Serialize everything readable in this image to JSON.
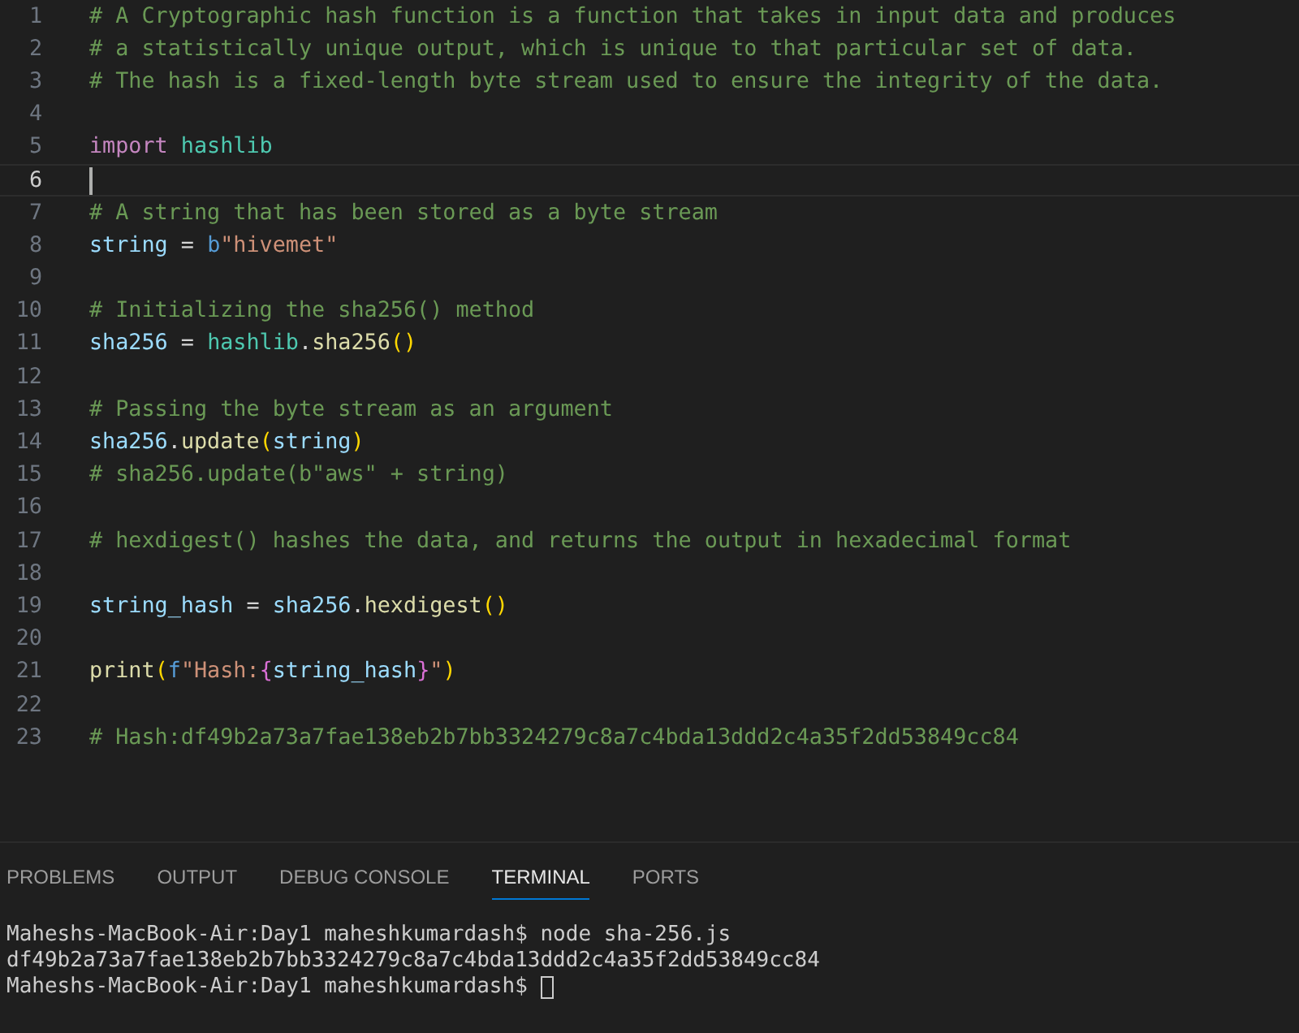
{
  "editor": {
    "lines": [
      {
        "number": "1",
        "current": false,
        "tokens": [
          {
            "text": "# A Cryptographic hash function is a function that takes in input data and produces",
            "kind": "comment"
          }
        ]
      },
      {
        "number": "2",
        "current": false,
        "tokens": [
          {
            "text": "# a statistically unique output, which is unique to that particular set of data.",
            "kind": "comment"
          }
        ]
      },
      {
        "number": "3",
        "current": false,
        "tokens": [
          {
            "text": "# The hash is a fixed-length byte stream used to ensure the integrity of the data.",
            "kind": "comment"
          }
        ]
      },
      {
        "number": "4",
        "current": false
      },
      {
        "number": "5",
        "current": false,
        "tokens": [
          {
            "text": "import",
            "kind": "keyword"
          },
          {
            "text": " hashlib",
            "kind": "module"
          }
        ]
      },
      {
        "number": "6",
        "current": true
      },
      {
        "number": "7",
        "current": false,
        "tokens": [
          {
            "text": "# A string that has been stored as a byte stream",
            "kind": "comment"
          }
        ]
      },
      {
        "number": "8",
        "current": false,
        "tokens": [
          {
            "text": "string",
            "kind": "variable"
          },
          {
            "text": " = ",
            "kind": "plain"
          },
          {
            "text": "b",
            "kind": "prefix"
          },
          {
            "text": "\"hivemet\"",
            "kind": "string"
          }
        ]
      },
      {
        "number": "9",
        "current": false
      },
      {
        "number": "10",
        "current": false,
        "tokens": [
          {
            "text": "# Initializing the sha256() method",
            "kind": "comment"
          }
        ]
      },
      {
        "number": "11",
        "current": false,
        "tokens": [
          {
            "text": "sha256",
            "kind": "variable"
          },
          {
            "text": " = ",
            "kind": "plain"
          },
          {
            "text": "hashlib",
            "kind": "module"
          },
          {
            "text": ".",
            "kind": "plain"
          },
          {
            "text": "sha256",
            "kind": "function"
          },
          {
            "text": "()",
            "kind": "paren"
          }
        ]
      },
      {
        "number": "12",
        "current": false
      },
      {
        "number": "13",
        "current": false,
        "tokens": [
          {
            "text": "# Passing the byte stream as an argument",
            "kind": "comment"
          }
        ]
      },
      {
        "number": "14",
        "current": false,
        "tokens": [
          {
            "text": "sha256",
            "kind": "variable"
          },
          {
            "text": ".",
            "kind": "plain"
          },
          {
            "text": "update",
            "kind": "function"
          },
          {
            "text": "(",
            "kind": "paren"
          },
          {
            "text": "string",
            "kind": "variable"
          },
          {
            "text": ")",
            "kind": "paren"
          }
        ]
      },
      {
        "number": "15",
        "current": false,
        "tokens": [
          {
            "text": "# sha256.update(b\"aws\" + string)",
            "kind": "comment"
          }
        ]
      },
      {
        "number": "16",
        "current": false
      },
      {
        "number": "17",
        "current": false,
        "tokens": [
          {
            "text": "# hexdigest() hashes the data, and returns the output in hexadecimal format",
            "kind": "comment"
          }
        ]
      },
      {
        "number": "18",
        "current": false
      },
      {
        "number": "19",
        "current": false,
        "tokens": [
          {
            "text": "string_hash",
            "kind": "variable"
          },
          {
            "text": " = ",
            "kind": "plain"
          },
          {
            "text": "sha256",
            "kind": "variable"
          },
          {
            "text": ".",
            "kind": "plain"
          },
          {
            "text": "hexdigest",
            "kind": "function"
          },
          {
            "text": "()",
            "kind": "paren"
          }
        ]
      },
      {
        "number": "20",
        "current": false
      },
      {
        "number": "21",
        "current": false,
        "tokens": [
          {
            "text": "print",
            "kind": "function"
          },
          {
            "text": "(",
            "kind": "paren"
          },
          {
            "text": "f",
            "kind": "prefix"
          },
          {
            "text": "\"Hash:",
            "kind": "string"
          },
          {
            "text": "{",
            "kind": "brace"
          },
          {
            "text": "string_hash",
            "kind": "variable"
          },
          {
            "text": "}",
            "kind": "brace"
          },
          {
            "text": "\"",
            "kind": "string"
          },
          {
            "text": ")",
            "kind": "paren"
          }
        ]
      },
      {
        "number": "22",
        "current": false
      },
      {
        "number": "23",
        "current": false,
        "tokens": [
          {
            "text": "# Hash:df49b2a73a7fae138eb2b7bb3324279c8a7c4bda13ddd2c4a35f2dd53849cc84",
            "kind": "comment"
          }
        ]
      }
    ]
  },
  "panel": {
    "tabs": [
      {
        "label": "PROBLEMS",
        "selected": false
      },
      {
        "label": "OUTPUT",
        "selected": false
      },
      {
        "label": "DEBUG CONSOLE",
        "selected": false
      },
      {
        "label": "TERMINAL",
        "selected": true
      },
      {
        "label": "PORTS",
        "selected": false
      }
    ],
    "terminal_lines": [
      {
        "text": "Maheshs-MacBook-Air:Day1 maheshkumardash$ node sha-256.js",
        "cursor": false
      },
      {
        "text": "df49b2a73a7fae138eb2b7bb3324279c8a7c4bda13ddd2c4a35f2dd53849cc84",
        "cursor": false
      },
      {
        "text": "Maheshs-MacBook-Air:Day1 maheshkumardash$ ",
        "cursor": true
      }
    ]
  }
}
